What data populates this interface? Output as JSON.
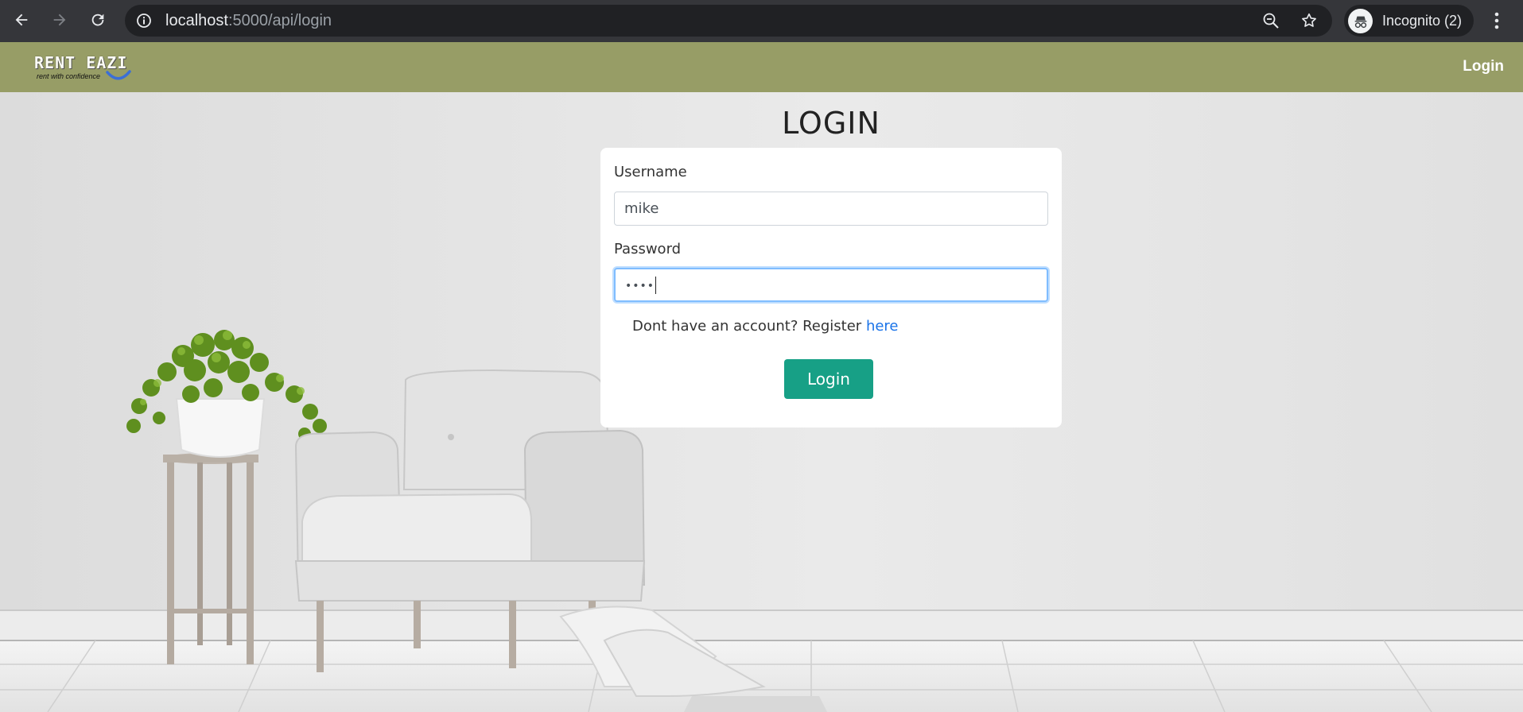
{
  "browser": {
    "url_host": "localhost",
    "url_rest": ":5000/api/login",
    "profile_label": "Incognito (2)"
  },
  "navbar": {
    "brand_name": "RENT EAZI",
    "brand_tagline": "rent with confidence",
    "login_link": "Login",
    "background_color": "#979d66"
  },
  "login": {
    "title": "LOGIN",
    "username_label": "Username",
    "username_value": "mike",
    "password_label": "Password",
    "password_value": "••••",
    "register_text": "Dont have an account? Register ",
    "register_link": "here",
    "submit_label": "Login",
    "button_color": "#17a086"
  }
}
